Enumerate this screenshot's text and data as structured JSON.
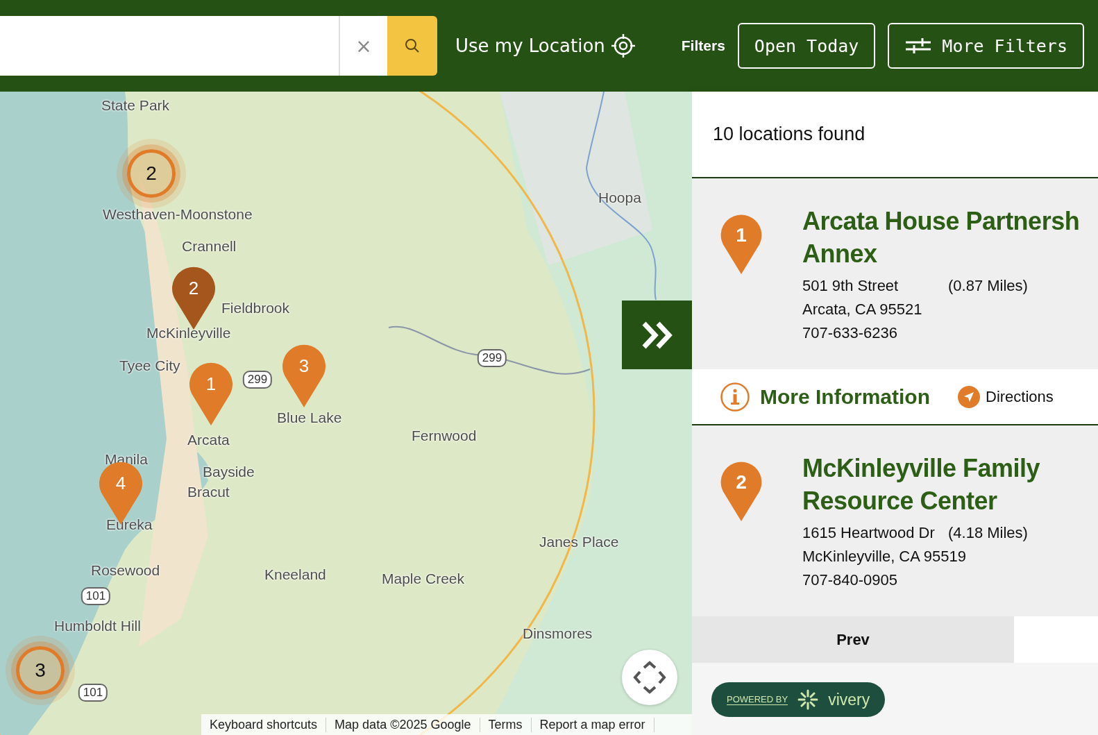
{
  "header": {
    "clear_button": "×",
    "location_button": "Use my Location",
    "filters_label": "Filters",
    "filter_buttons": [
      {
        "label": "Open Today",
        "kind": "plain"
      },
      {
        "label": "More Filters",
        "kind": "sliders"
      }
    ]
  },
  "map": {
    "labels": [
      "State Park",
      "Westhaven-Moonstone",
      "Crannell",
      "Fieldbrook",
      "McKinleyville",
      "Tyee City",
      "Blue Lake",
      "Arcata",
      "Manila",
      "Bayside",
      "Bracut",
      "Eureka",
      "Rosewood",
      "Humboldt Hill",
      "Hoopa",
      "Fernwood",
      "Janes Place",
      "Kneeland",
      "Maple Creek",
      "Dinsmores"
    ],
    "shields": [
      "299",
      "299",
      "101",
      "101"
    ],
    "pins": [
      {
        "number": "2",
        "color": "#a5561d"
      },
      {
        "number": "1",
        "color": "#e07b2a"
      },
      {
        "number": "3",
        "color": "#e07b2a"
      },
      {
        "number": "4",
        "color": "#e07b2a"
      }
    ],
    "clusters": [
      {
        "count": "2"
      },
      {
        "count": "3"
      }
    ],
    "attribution": [
      "Keyboard shortcuts",
      "Map data ©2025 Google",
      "Terms",
      "Report a map error"
    ]
  },
  "results": {
    "count": "10 locations found",
    "locations": [
      {
        "marker": "1",
        "title_lines": [
          "Arcata House Partnersh",
          "Annex"
        ],
        "street": "501 9th Street",
        "distance": "(0.87 Miles)",
        "city": "Arcata, CA 95521",
        "phone": "707-633-6236",
        "actions": [
          {
            "label": "More Information",
            "kind": "info"
          },
          {
            "label": "Directions",
            "kind": "directions"
          }
        ]
      },
      {
        "marker": "2",
        "title_lines": [
          "McKinleyville Family",
          "Resource Center"
        ],
        "street": "1615 Heartwood Dr",
        "distance": "(4.18 Miles)",
        "city": "McKinleyville, CA 95519",
        "phone": "707-840-0905"
      }
    ],
    "pagination": {
      "prev": "Prev"
    },
    "footer": {
      "powered_by": "POWERED BY",
      "brand": "vivery"
    }
  }
}
